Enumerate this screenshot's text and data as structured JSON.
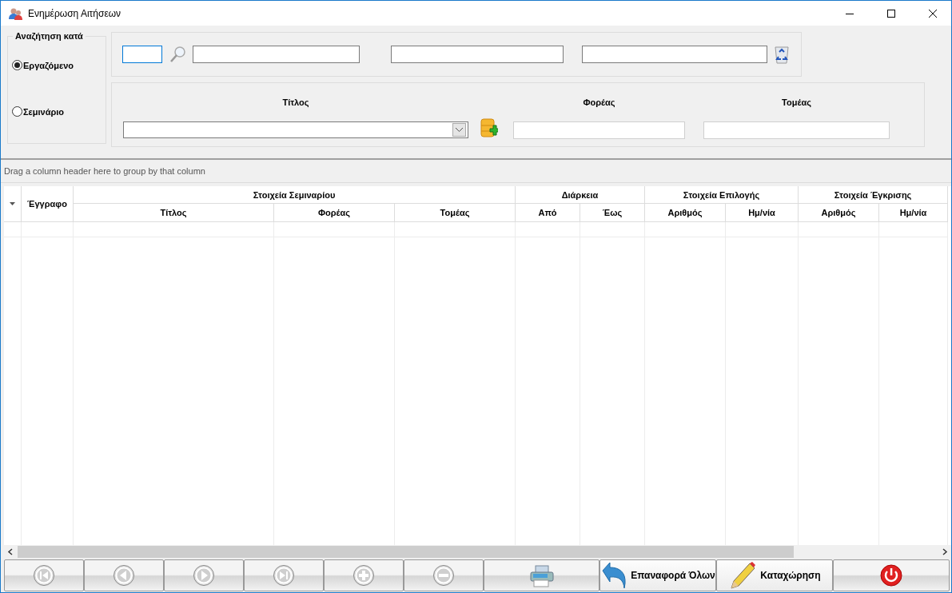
{
  "window": {
    "title": "Ενημέρωση Αιτήσεων"
  },
  "search_by": {
    "label": "Αναζήτηση κατά",
    "options": [
      {
        "label": "Εργαζόμενο",
        "selected": true
      },
      {
        "label": "Σεμινάριο",
        "selected": false
      }
    ]
  },
  "employee_fields": [
    {
      "focused": true
    },
    {
      "focused": false
    },
    {
      "focused": false
    },
    {
      "focused": false
    }
  ],
  "seminar": {
    "title_label": "Τίτλος",
    "foreas_label": "Φορέας",
    "tomeas_label": "Τομέας"
  },
  "grid": {
    "group_panel_hint": "Drag a column header here to group by that column",
    "first_column": "Έγγραφο",
    "bands": [
      {
        "label": "Στοιχεία Σεμιναρίου",
        "columns": [
          "Τίτλος",
          "Φορέας",
          "Τομέας"
        ]
      },
      {
        "label": "Διάρκεια",
        "columns": [
          "Από",
          "Έως"
        ]
      },
      {
        "label": "Στοιχεία Επιλογής",
        "columns": [
          "Αριθμός",
          "Ημ/νία"
        ]
      },
      {
        "label": "Στοιχεία Έγκρισης",
        "columns": [
          "Αριθμός",
          "Ημ/νία"
        ]
      }
    ]
  },
  "toolbar": [
    {
      "kind": "first"
    },
    {
      "kind": "prev"
    },
    {
      "kind": "next"
    },
    {
      "kind": "last"
    },
    {
      "kind": "add"
    },
    {
      "kind": "remove"
    },
    {
      "kind": "print"
    },
    {
      "kind": "reset",
      "label": "Επαναφορά Όλων"
    },
    {
      "kind": "save",
      "label": "Καταχώρηση"
    },
    {
      "kind": "power"
    }
  ]
}
